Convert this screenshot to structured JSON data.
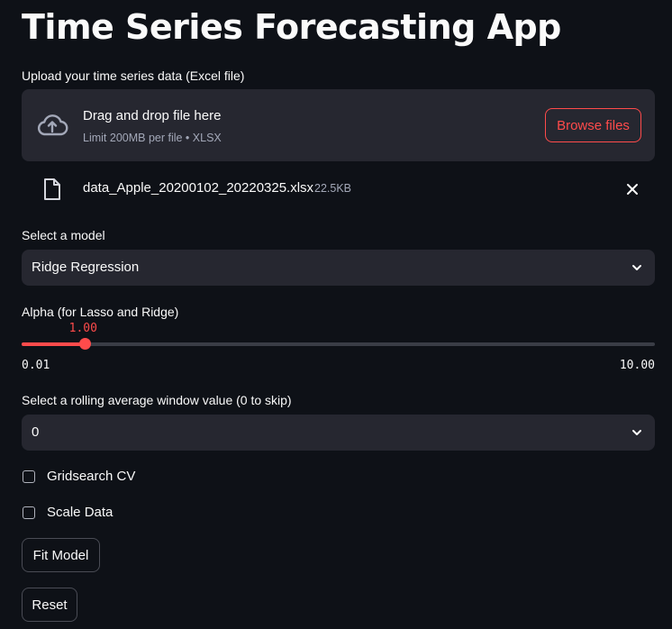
{
  "app": {
    "title": "Time Series Forecasting App"
  },
  "uploader": {
    "label": "Upload your time series data (Excel file)",
    "drop_title": "Drag and drop file here",
    "drop_subtitle": "Limit 200MB per file • XLSX",
    "browse_label": "Browse files",
    "file": {
      "name": "data_Apple_20200102_20220325.xlsx",
      "size": "22.5KB"
    }
  },
  "model_select": {
    "label": "Select a model",
    "value": "Ridge Regression"
  },
  "alpha_slider": {
    "label": "Alpha (for Lasso and Ridge)",
    "value_text": "1.00",
    "min_text": "0.01",
    "max_text": "10.00",
    "value": 1.0,
    "min": 0.01,
    "max": 10.0
  },
  "rolling_select": {
    "label": "Select a rolling average window value (0 to skip)",
    "value": "0"
  },
  "checkboxes": [
    {
      "label": "Gridsearch CV",
      "checked": false
    },
    {
      "label": "Scale Data",
      "checked": false
    }
  ],
  "buttons": {
    "fit_label": "Fit Model",
    "reset_label": "Reset"
  },
  "colors": {
    "accent": "#ff4b4b",
    "background": "#0e1117",
    "surface": "#262730",
    "muted_text": "#a3a8b8"
  }
}
